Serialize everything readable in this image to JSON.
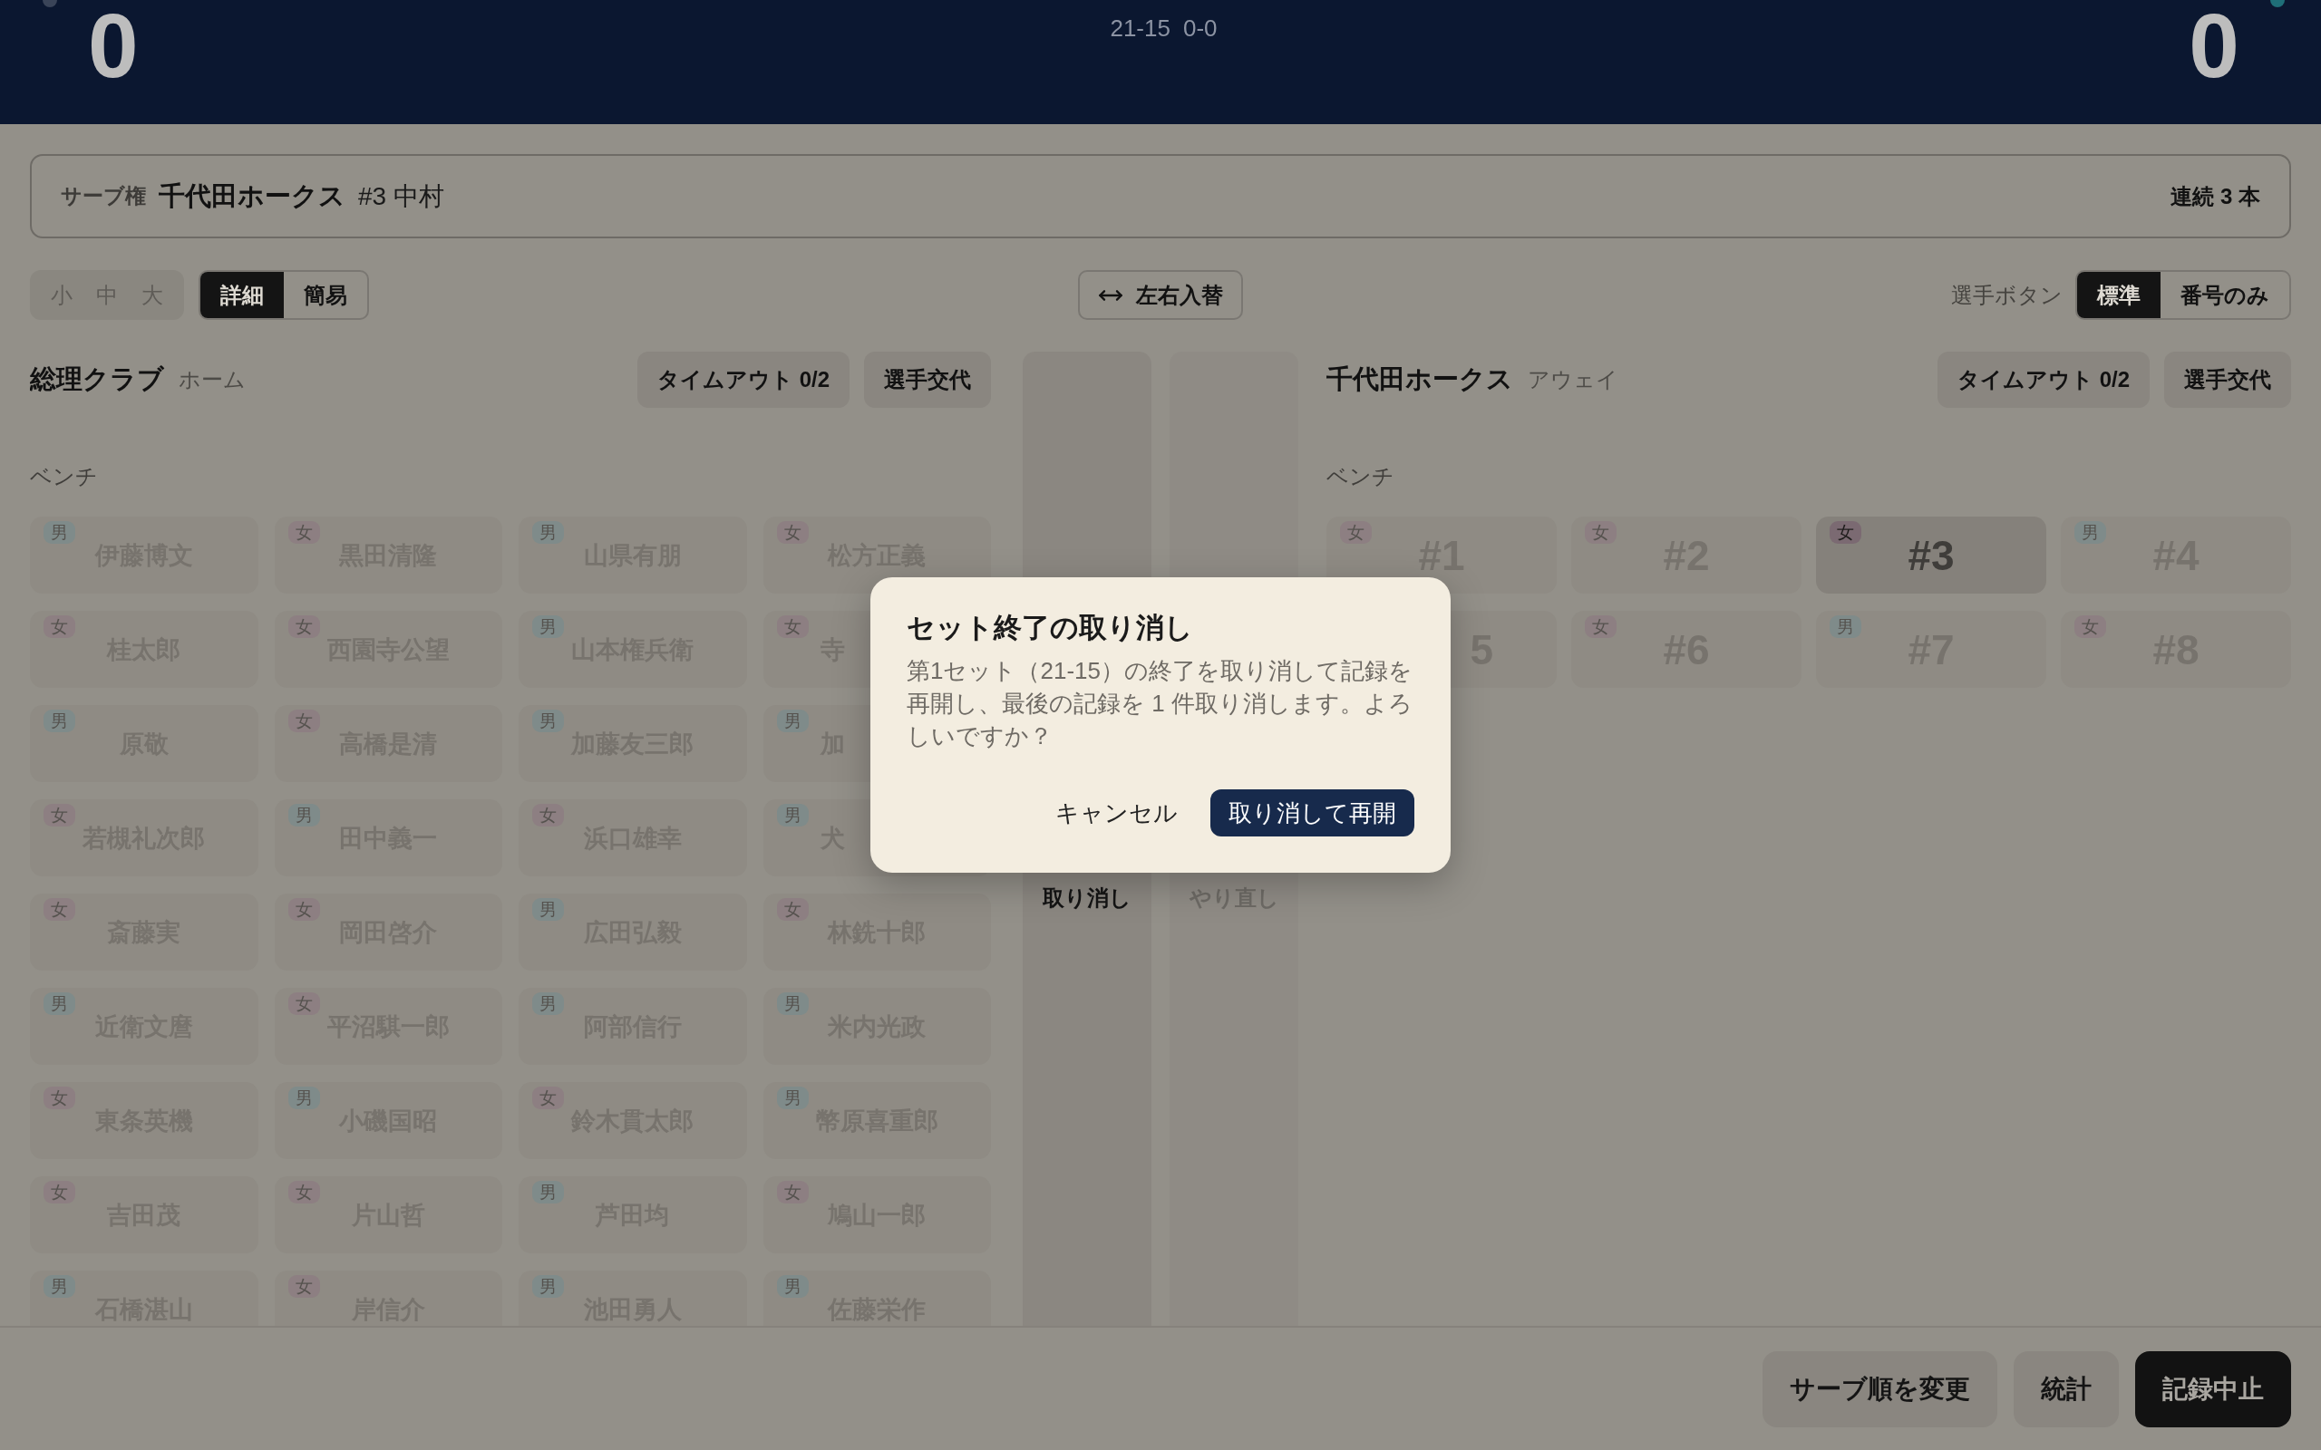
{
  "scoreboard": {
    "teams": [
      {
        "score": "0",
        "serving": false
      },
      {
        "score": "0",
        "serving": true
      }
    ],
    "set_scores": "21-15",
    "current": "0-0"
  },
  "serve_bar": {
    "label": "サーブ権",
    "team": "千代田ホークス",
    "player": "#3 中村",
    "streak": "連続 3 本"
  },
  "toolbar": {
    "size_options": [
      {
        "label": "小",
        "selected": false
      },
      {
        "label": "中",
        "selected": false
      },
      {
        "label": "大",
        "selected": false
      }
    ],
    "view_options": [
      {
        "label": "詳細",
        "selected": true
      },
      {
        "label": "簡易",
        "selected": false
      }
    ],
    "swap_button": "左右入替",
    "player_button_label": "選手ボタン",
    "player_button_options": [
      {
        "label": "標準",
        "selected": true
      },
      {
        "label": "番号のみ",
        "selected": false
      }
    ]
  },
  "teams": [
    {
      "name": "総理クラブ",
      "side": "ホーム",
      "timeout": "タイムアウト 0/2",
      "substitute": "選手交代",
      "bench_label": "ベンチ",
      "kind": "names",
      "players": [
        {
          "name": "伊藤博文",
          "gender": "男",
          "color": "#7f8b8a",
          "selected": false
        },
        {
          "name": "黒田清隆",
          "gender": "女",
          "color": "#8d7f82",
          "selected": false
        },
        {
          "name": "山県有朋",
          "gender": "男",
          "color": "#7f8b8a",
          "selected": false
        },
        {
          "name": "松方正義",
          "gender": "女",
          "color": "#8d7f82",
          "selected": false
        },
        {
          "name": "桂太郎",
          "gender": "女",
          "color": "#8d7f82",
          "selected": false
        },
        {
          "name": "西園寺公望",
          "gender": "女",
          "color": "#8d7f82",
          "selected": false
        },
        {
          "name": "山本権兵衛",
          "gender": "男",
          "color": "#7f8b8a",
          "selected": false
        },
        {
          "name": "寺",
          "gender": "女",
          "color": "#8d7f82",
          "selected": false,
          "kind": "cut_start"
        },
        {
          "name": "原敬",
          "gender": "男",
          "color": "#7f8b8a",
          "selected": false
        },
        {
          "name": "高橋是清",
          "gender": "女",
          "color": "#8d7f82",
          "selected": false
        },
        {
          "name": "加藤友三郎",
          "gender": "男",
          "color": "#7f8b8a",
          "selected": false
        },
        {
          "name": "加",
          "gender": "男",
          "color": "#7f8b8a",
          "selected": false,
          "kind": "cut_start"
        },
        {
          "name": "若槻礼次郎",
          "gender": "女",
          "color": "#8d7f82",
          "selected": false
        },
        {
          "name": "田中義一",
          "gender": "男",
          "color": "#7f8b8a",
          "selected": false
        },
        {
          "name": "浜口雄幸",
          "gender": "女",
          "color": "#8d7f82",
          "selected": false
        },
        {
          "name": "犬",
          "gender": "男",
          "color": "#7f8b8a",
          "selected": false,
          "kind": "cut_start"
        },
        {
          "name": "斎藤実",
          "gender": "女",
          "color": "#8d7f82",
          "selected": false
        },
        {
          "name": "岡田啓介",
          "gender": "女",
          "color": "#8d7f82",
          "selected": false
        },
        {
          "name": "広田弘毅",
          "gender": "男",
          "color": "#7f8b8a",
          "selected": false
        },
        {
          "name": "林銑十郎",
          "gender": "女",
          "color": "#8d7f82",
          "selected": false
        },
        {
          "name": "近衛文麿",
          "gender": "男",
          "color": "#7f8b8a",
          "selected": false
        },
        {
          "name": "平沼騏一郎",
          "gender": "女",
          "color": "#8d7f82",
          "selected": false
        },
        {
          "name": "阿部信行",
          "gender": "男",
          "color": "#7f8b8a",
          "selected": false
        },
        {
          "name": "米内光政",
          "gender": "男",
          "color": "#7f8b8a",
          "selected": false
        },
        {
          "name": "東条英機",
          "gender": "女",
          "color": "#8d7f82",
          "selected": false
        },
        {
          "name": "小磯国昭",
          "gender": "男",
          "color": "#7f8b8a",
          "selected": false
        },
        {
          "name": "鈴木貫太郎",
          "gender": "女",
          "color": "#8d7f82",
          "selected": false
        },
        {
          "name": "幣原喜重郎",
          "gender": "男",
          "color": "#7f8b8a",
          "selected": false
        },
        {
          "name": "吉田茂",
          "gender": "女",
          "color": "#8d7f82",
          "selected": false
        },
        {
          "name": "片山哲",
          "gender": "女",
          "color": "#8d7f82",
          "selected": false
        },
        {
          "name": "芦田均",
          "gender": "男",
          "color": "#7f8b8a",
          "selected": false
        },
        {
          "name": "鳩山一郎",
          "gender": "女",
          "color": "#8d7f82",
          "selected": false
        },
        {
          "name": "石橋湛山",
          "gender": "男",
          "color": "#7f8b8a",
          "selected": false
        },
        {
          "name": "岸信介",
          "gender": "女",
          "color": "#8d7f82",
          "selected": false
        },
        {
          "name": "池田勇人",
          "gender": "男",
          "color": "#7f8b8a",
          "selected": false
        },
        {
          "name": "佐藤栄作",
          "gender": "男",
          "color": "#7f8b8a",
          "selected": false
        }
      ]
    },
    {
      "name": "千代田ホークス",
      "side": "アウェイ",
      "timeout": "タイムアウト 0/2",
      "substitute": "選手交代",
      "bench_label": "ベンチ",
      "kind": "numbers",
      "players": [
        {
          "name": "#1",
          "gender": "女",
          "color": "#8d7f82",
          "selected": false
        },
        {
          "name": "#2",
          "gender": "女",
          "color": "#8d7f82",
          "selected": false
        },
        {
          "name": "#3",
          "gender": "女",
          "color": "#7b6a72",
          "selected": true
        },
        {
          "name": "#4",
          "gender": "男",
          "color": "#7f8b8a",
          "selected": false
        },
        {
          "name": "5",
          "selected": false,
          "kind": "cut_end"
        },
        {
          "name": "#6",
          "gender": "女",
          "color": "#8d7f82",
          "selected": false
        },
        {
          "name": "#7",
          "gender": "男",
          "color": "#7f8b8a",
          "selected": false
        },
        {
          "name": "#8",
          "gender": "女",
          "color": "#8d7f82",
          "selected": false
        }
      ]
    }
  ],
  "history_controls": [
    {
      "label": "取り消し",
      "disabled": false
    },
    {
      "label": "やり直し",
      "disabled": true
    }
  ],
  "footer": {
    "buttons": [
      {
        "label": "サーブ順を変更",
        "kind": "secondary"
      },
      {
        "label": "統計",
        "kind": "secondary"
      },
      {
        "label": "記録中止",
        "kind": "primary"
      }
    ]
  },
  "dialog": {
    "title": "セット終了の取り消し",
    "message": "第1セット（21-15）の終了を取り消して記録を再開し、最後の記録を 1 件取り消します。よろしいですか？",
    "buttons": [
      {
        "label": "キャンセル",
        "kind": "text"
      },
      {
        "label": "取り消して再開",
        "kind": "primary"
      }
    ]
  }
}
